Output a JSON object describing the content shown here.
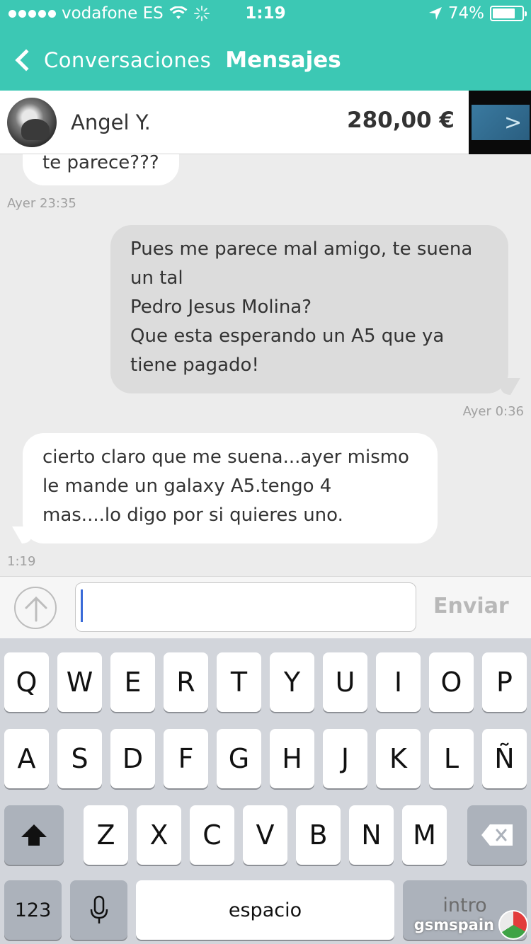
{
  "status": {
    "carrier": "vodafone ES",
    "time": "1:19",
    "battery": "74%"
  },
  "nav": {
    "back_label": "Conversaciones",
    "title": "Mensajes"
  },
  "header": {
    "name": "Angel Y.",
    "price": "280,00 €"
  },
  "messages": [
    {
      "side": "in",
      "text": "te parece???",
      "time": "Ayer 23:35"
    },
    {
      "side": "out",
      "lines": [
        "Pues me parece mal amigo, te suena",
        "un tal",
        "Pedro Jesus Molina?",
        "Que esta esperando un A5 que ya",
        "tiene pagado!"
      ],
      "time": "Ayer 0:36"
    },
    {
      "side": "in",
      "lines": [
        "cierto claro que me suena...ayer mismo",
        "le mande un galaxy A5.tengo 4",
        "mas....lo digo por si quieres uno."
      ],
      "time": "1:19"
    }
  ],
  "composer": {
    "placeholder": "",
    "send_label": "Enviar"
  },
  "keyboard": {
    "row1": [
      "Q",
      "W",
      "E",
      "R",
      "T",
      "Y",
      "U",
      "I",
      "O",
      "P"
    ],
    "row2": [
      "A",
      "S",
      "D",
      "F",
      "G",
      "H",
      "J",
      "K",
      "L",
      "Ñ"
    ],
    "row3": [
      "Z",
      "X",
      "C",
      "V",
      "B",
      "N",
      "M"
    ],
    "numbers_label": "123",
    "space_label": "espacio",
    "return_label": "intro"
  },
  "watermark": "gsmspain"
}
